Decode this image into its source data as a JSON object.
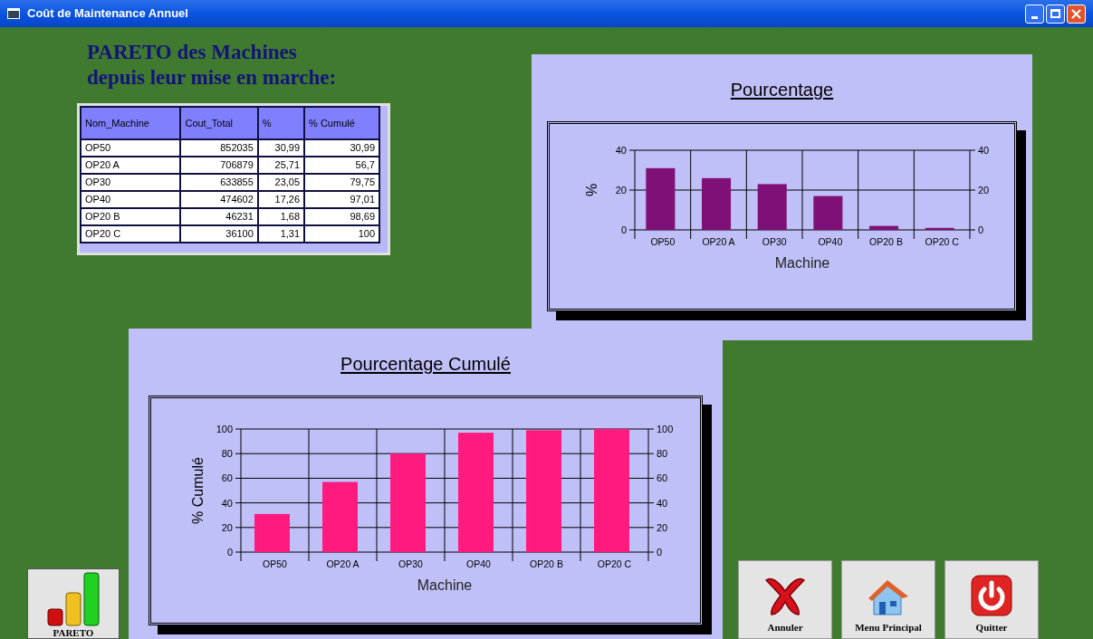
{
  "window": {
    "title": "Coût de Maintenance Annuel"
  },
  "heading": [
    "PARETO des Machines",
    "depuis leur mise en marche:"
  ],
  "table": {
    "columns": [
      "Nom_Machine",
      "Cout_Total",
      "%",
      "% Cumulé"
    ],
    "rows": [
      [
        "OP50",
        "852035",
        "30,99",
        "30,99"
      ],
      [
        "OP20 A",
        "706879",
        "25,71",
        "56,7"
      ],
      [
        "OP30",
        "633855",
        "23,05",
        "79,75"
      ],
      [
        "OP40",
        "474602",
        "17,26",
        "97,01"
      ],
      [
        "OP20 B",
        "46231",
        "1,68",
        "98,69"
      ],
      [
        "OP20 C",
        "36100",
        "1,31",
        "100"
      ]
    ]
  },
  "charts": [
    {
      "chart_data": {
        "type": "bar",
        "title": "Pourcentage",
        "xlabel": "Machine",
        "ylabel": "%",
        "categories": [
          "OP50",
          "OP20 A",
          "OP30",
          "OP40",
          "OP20 B",
          "OP20 C"
        ],
        "series": [
          {
            "color": "#7f1077",
            "values": [
              31,
              26,
              23,
              17,
              2,
              1
            ]
          }
        ],
        "ylim": [
          0,
          40
        ],
        "yticks": [
          0,
          20,
          40
        ],
        "y2ticks": [
          0,
          20,
          40
        ],
        "y2lim": [
          0,
          40
        ],
        "grid": true
      }
    },
    {
      "chart_data": {
        "type": "bar",
        "title": "Pourcentage Cumulé",
        "xlabel": "Machine",
        "ylabel": "% Cumulé",
        "categories": [
          "OP50",
          "OP20 A",
          "OP30",
          "OP40",
          "OP20 B",
          "OP20 C"
        ],
        "series": [
          {
            "color": "#ff1a80",
            "values": [
              31,
              57,
              80,
              97,
              99,
              100
            ]
          }
        ],
        "ylim": [
          0,
          100
        ],
        "yticks": [
          0,
          20,
          40,
          60,
          80,
          100
        ],
        "y2ticks": [
          0,
          20,
          40,
          60,
          80,
          100
        ],
        "y2lim": [
          0,
          100
        ],
        "grid": true
      }
    }
  ],
  "pareto_button": {
    "label": "PARETO"
  },
  "buttons": [
    {
      "kind": "cancel",
      "label": "Annuler"
    },
    {
      "kind": "home",
      "label": "Menu Principal"
    },
    {
      "kind": "power",
      "label": "Quitter"
    }
  ]
}
